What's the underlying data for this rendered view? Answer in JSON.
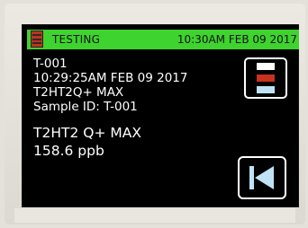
{
  "status_bar": {
    "title": "TESTING",
    "datetime": "10:30AM FEB 09 2017",
    "color": "#3ed32e"
  },
  "record": {
    "id": "T-001",
    "timestamp": "10:29:25AM FEB 09 2017",
    "test_name": "T2HT2Q+ MAX",
    "sample_id_line": "Sample ID: T-001"
  },
  "result": {
    "test_label": "T2HT2 Q+ MAX",
    "value": "158.6 ppb"
  },
  "icons": {
    "status": "status-indicator-icon",
    "menu": "menu-icon",
    "back": "skip-back-icon"
  }
}
